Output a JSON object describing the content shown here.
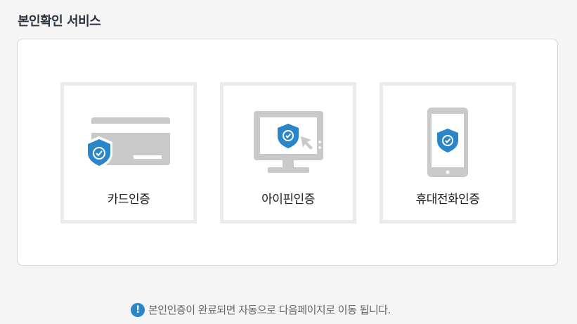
{
  "page": {
    "title": "본인확인 서비스"
  },
  "cards": [
    {
      "label": "카드인증",
      "icon": "credit-card-shield-icon"
    },
    {
      "label": "아이핀인증",
      "icon": "monitor-shield-cursor-icon"
    },
    {
      "label": "휴대전화인증",
      "icon": "mobile-phone-shield-icon"
    }
  ],
  "notice": {
    "icon": "exclamation-icon",
    "icon_glyph": "!",
    "text": "본인인증이 완료되면 자동으로 다음페이지로 이동 됩니다."
  },
  "colors": {
    "accent": "#2a86c9",
    "icon_gray": "#c9c9c9",
    "card_border": "#ebebeb",
    "background": "#f5f5f5"
  }
}
